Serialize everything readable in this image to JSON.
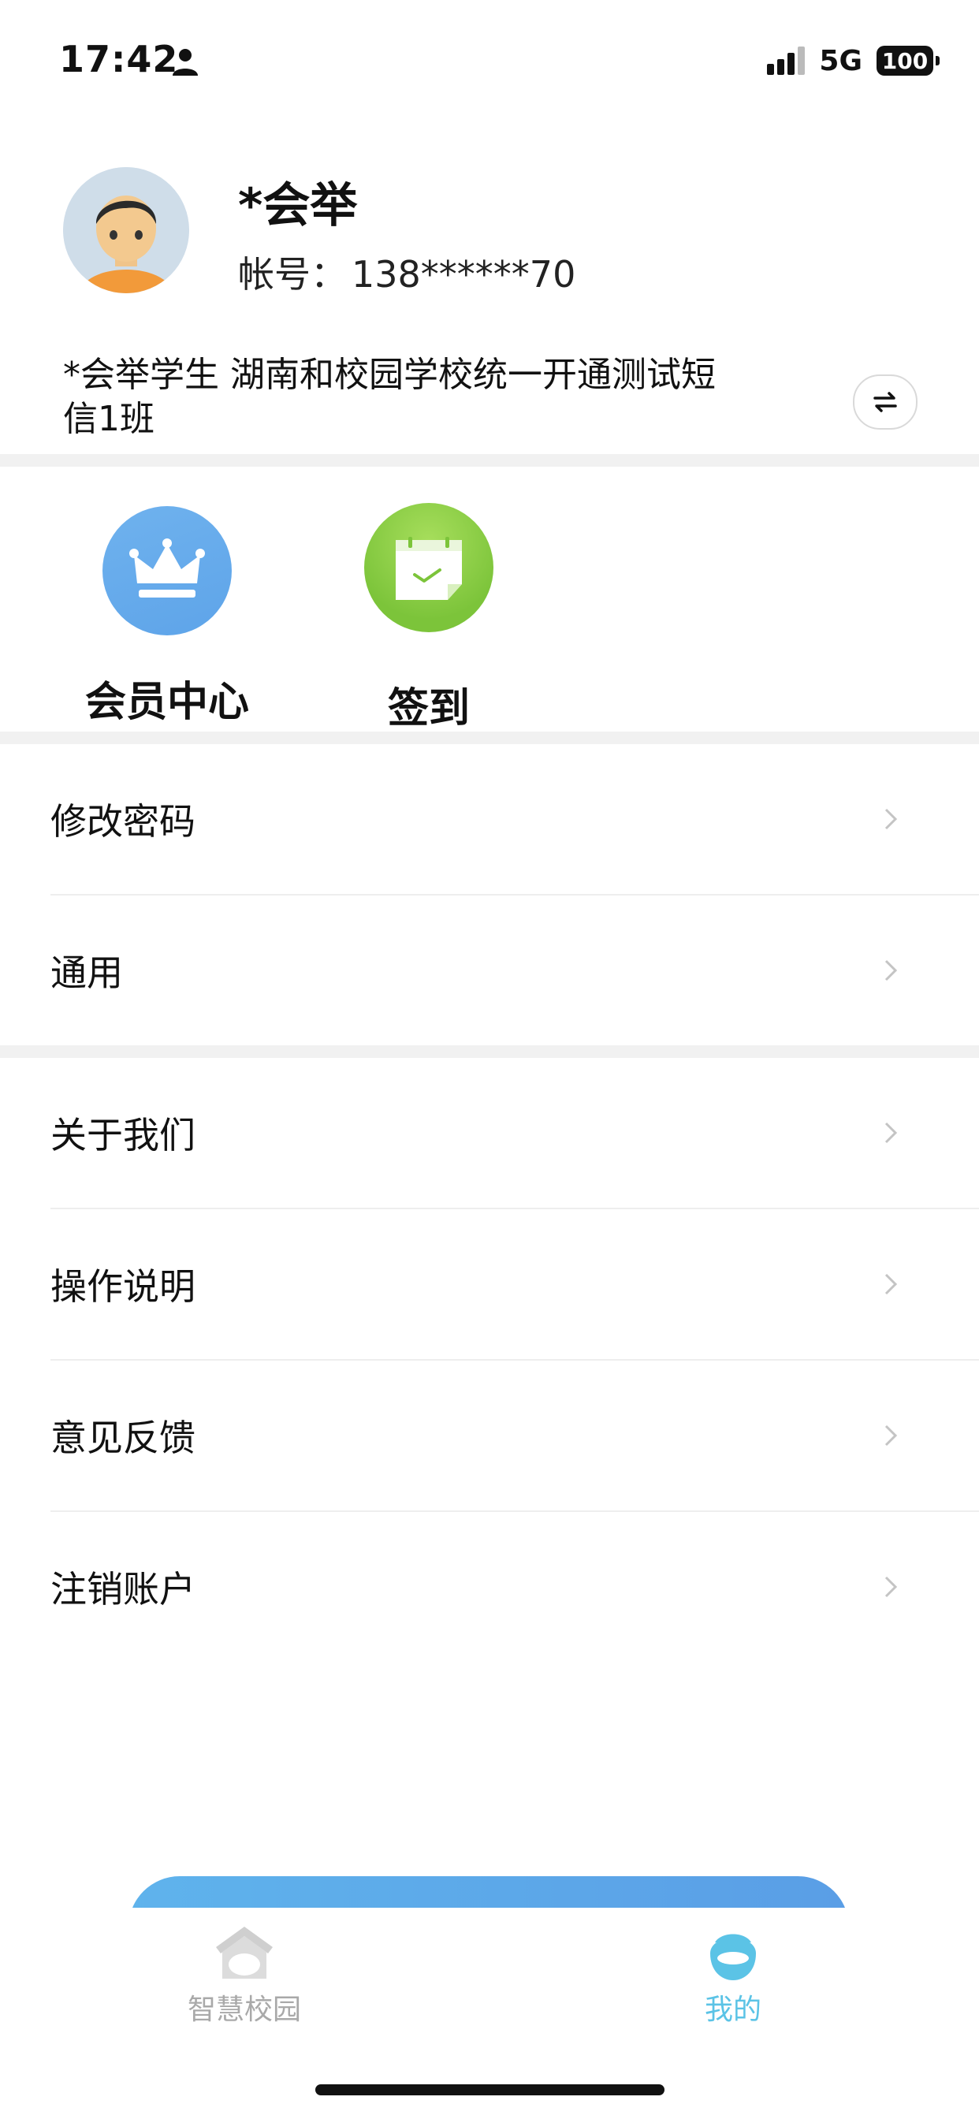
{
  "status_bar": {
    "time": "17:42",
    "network": "5G",
    "battery": "100",
    "icons": [
      "person-icon",
      "signal-icon",
      "battery-icon"
    ]
  },
  "profile": {
    "name": "*会举",
    "account_label": "帐号：",
    "account_value": "138******70",
    "org_line1": "*会举学生 湖南和校园学校统一开通测试短",
    "org_line2": "信1班",
    "switch_icon": "switch-arrows-icon"
  },
  "features": [
    {
      "label": "会员中心",
      "icon": "crown-icon"
    },
    {
      "label": "签到",
      "icon": "calendar-check-icon"
    }
  ],
  "menu": {
    "group1": [
      {
        "label": "修改密码"
      },
      {
        "label": "通用"
      }
    ],
    "group2": [
      {
        "label": "关于我们"
      },
      {
        "label": "操作说明"
      },
      {
        "label": "意见反馈"
      },
      {
        "label": "注销账户"
      }
    ]
  },
  "tabbar": {
    "tabs": [
      {
        "label": "智慧校园",
        "icon": "campus-home-icon",
        "active": false
      },
      {
        "label": "我的",
        "icon": "profile-face-icon",
        "active": true
      }
    ]
  },
  "colors": {
    "accent": "#5bc3e6",
    "member_blue": "#64aaeb",
    "checkin_green": "#8ccd44",
    "inactive_tab": "#a9a9a9"
  }
}
